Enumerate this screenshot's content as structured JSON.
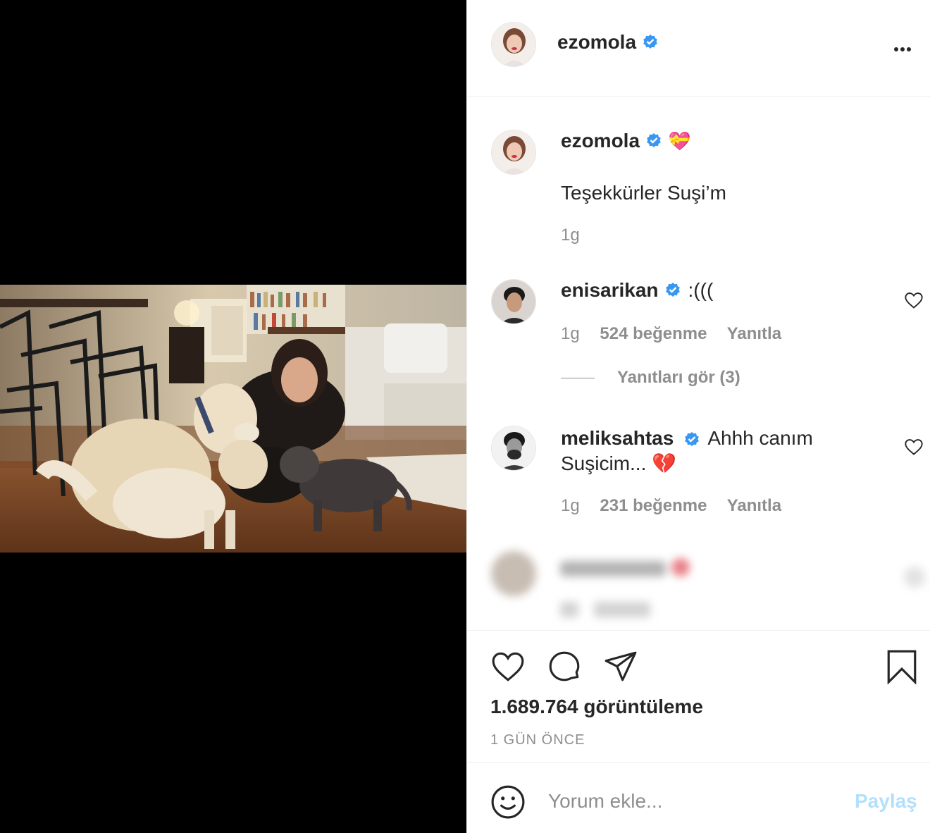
{
  "post": {
    "author": "ezomola",
    "verified": true,
    "more_icon": "more-horizontal-icon"
  },
  "comments": [
    {
      "user": "ezomola",
      "verified": true,
      "emoji": "💝",
      "text": "Teşekkürler Suşi’m",
      "time": "1g"
    },
    {
      "user": "enisarikan",
      "verified": true,
      "text": ":(((",
      "time": "1g",
      "likes": "524 beğenme",
      "reply": "Yanıtla",
      "view_replies": "Yanıtları gör (3)"
    },
    {
      "user": "meliksahtas",
      "verified": true,
      "text": "Ahhh canım Suşicim... 💔",
      "time": "1g",
      "likes": "231 beğenme",
      "reply": "Yanıtla"
    }
  ],
  "actions": {
    "like_icon": "heart-icon",
    "comment_icon": "comment-icon",
    "share_icon": "paper-plane-icon",
    "save_icon": "bookmark-icon",
    "views": "1.689.764 görüntüleme",
    "date": "1 GÜN ÖNCE"
  },
  "composer": {
    "placeholder": "Yorum ekle...",
    "share_label": "Paylaş"
  },
  "colors": {
    "verified_blue": "#3897f0",
    "muted_text": "#8e8e8e",
    "share_disabled": "#b2dffc"
  }
}
